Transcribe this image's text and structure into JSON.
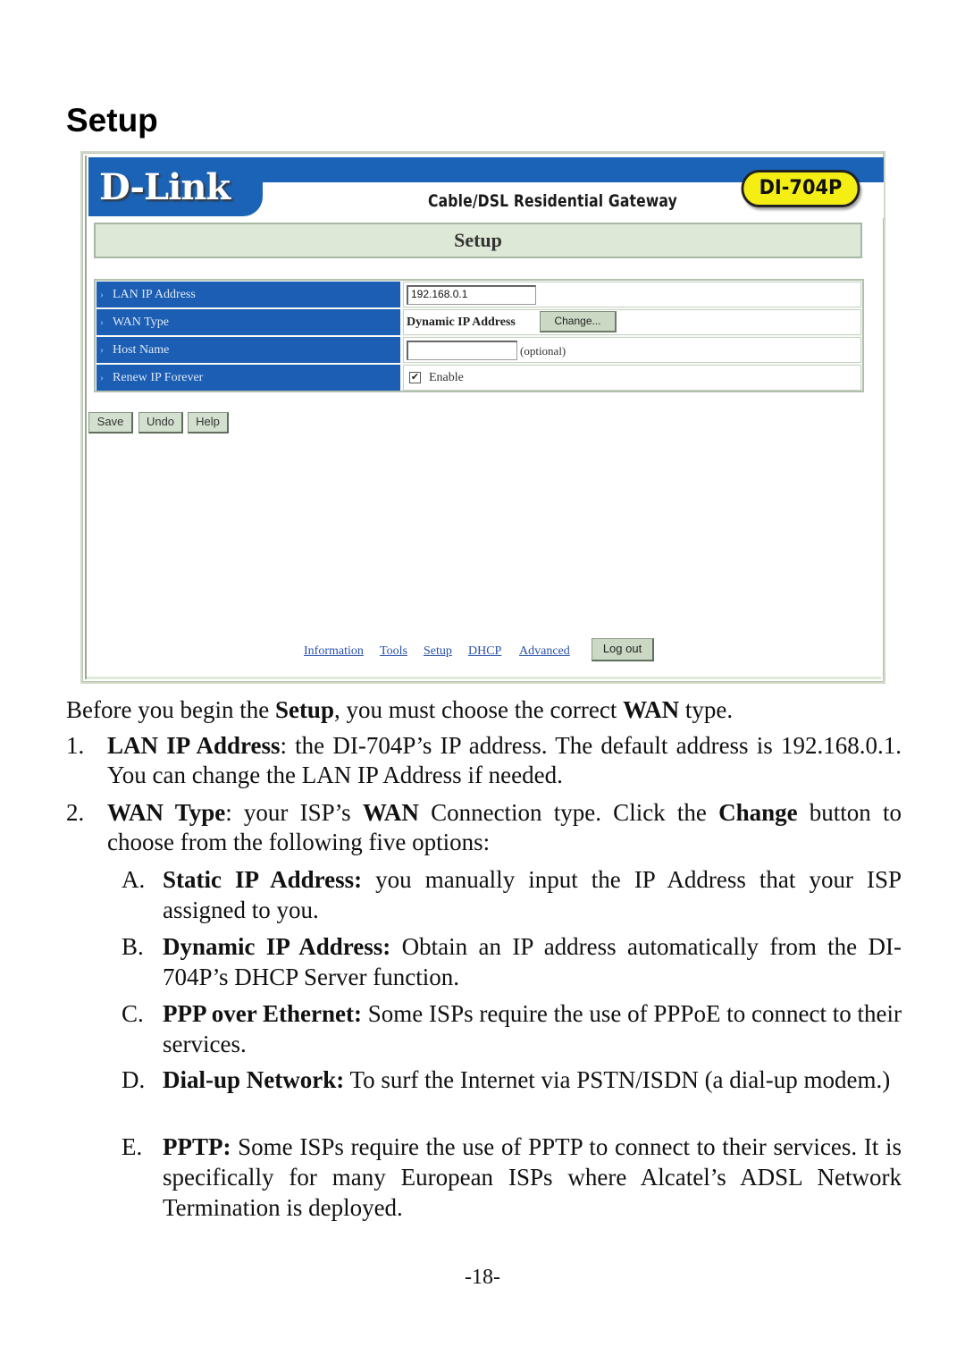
{
  "document": {
    "section_title": "Setup",
    "page_number": "-18-"
  },
  "screenshot": {
    "brand_logo": "D-Link",
    "product_title": "Cable/DSL Residential Gateway",
    "model_badge": "DI-704P",
    "colors": {
      "banner_blue": "#1b63b6",
      "label_blue": "#1b5eb3",
      "badge_yellow": "#f4ee14",
      "header_green": "#dde8d6",
      "link_blue": "#2850a8"
    },
    "page_header": "Setup",
    "form": {
      "rows": [
        {
          "label": "LAN IP Address",
          "input_value": "192.168.0.1"
        },
        {
          "label": "WAN Type",
          "value": "Dynamic IP Address",
          "button": "Change..."
        },
        {
          "label": "Host Name",
          "input_value": "",
          "note": "(optional)"
        },
        {
          "label": "Renew IP Forever",
          "checkbox_checked": true,
          "checkbox_label": "Enable"
        }
      ],
      "row_icon": "chevron-right-icon"
    },
    "actions": {
      "save": "Save",
      "undo": "Undo",
      "help": "Help"
    },
    "nav": {
      "links": [
        "Information",
        "Tools",
        "Setup",
        "DHCP",
        "Advanced"
      ],
      "logout": "Log out"
    }
  },
  "text": {
    "intro": {
      "pre": "Before you begin the ",
      "b1": "Setup",
      "mid": ", you must choose the correct ",
      "b2": "WAN",
      "post": " type."
    },
    "items": [
      {
        "num": "1.",
        "bold": "LAN IP Address",
        "text": ": the DI-704P’s IP address. The default address is 192.168.0.1. You can change the LAN IP Address if needed."
      },
      {
        "num": "2.",
        "bold": "WAN Type",
        "text1": ": your ISP’s ",
        "bold2": "WAN",
        "text2": " Connection type. Click the ",
        "bold3": "Change",
        "text3": " button to choose from the following five options:"
      }
    ],
    "options": [
      {
        "letter": "A.",
        "bold": "Static IP Address:",
        "text": " you manually input the IP Address that your ISP assigned to you."
      },
      {
        "letter": "B.",
        "bold": "Dynamic IP Address:",
        "text": " Obtain an IP address automatically from the DI-704P’s DHCP Server function."
      },
      {
        "letter": "C.",
        "bold": "PPP over Ethernet:",
        "text": " Some ISPs require the use of PPPoE to connect to their services."
      },
      {
        "letter": "D.",
        "bold": "Dial-up Network:",
        "text": " To surf the Internet via PSTN/ISDN (a dial-up modem.)"
      },
      {
        "letter": "E.",
        "bold": "PPTP:",
        "text": " Some ISPs require the use of PPTP to connect to their services. It is specifically for many European ISPs where Alcatel’s ADSL Network Termination is deployed."
      }
    ]
  }
}
